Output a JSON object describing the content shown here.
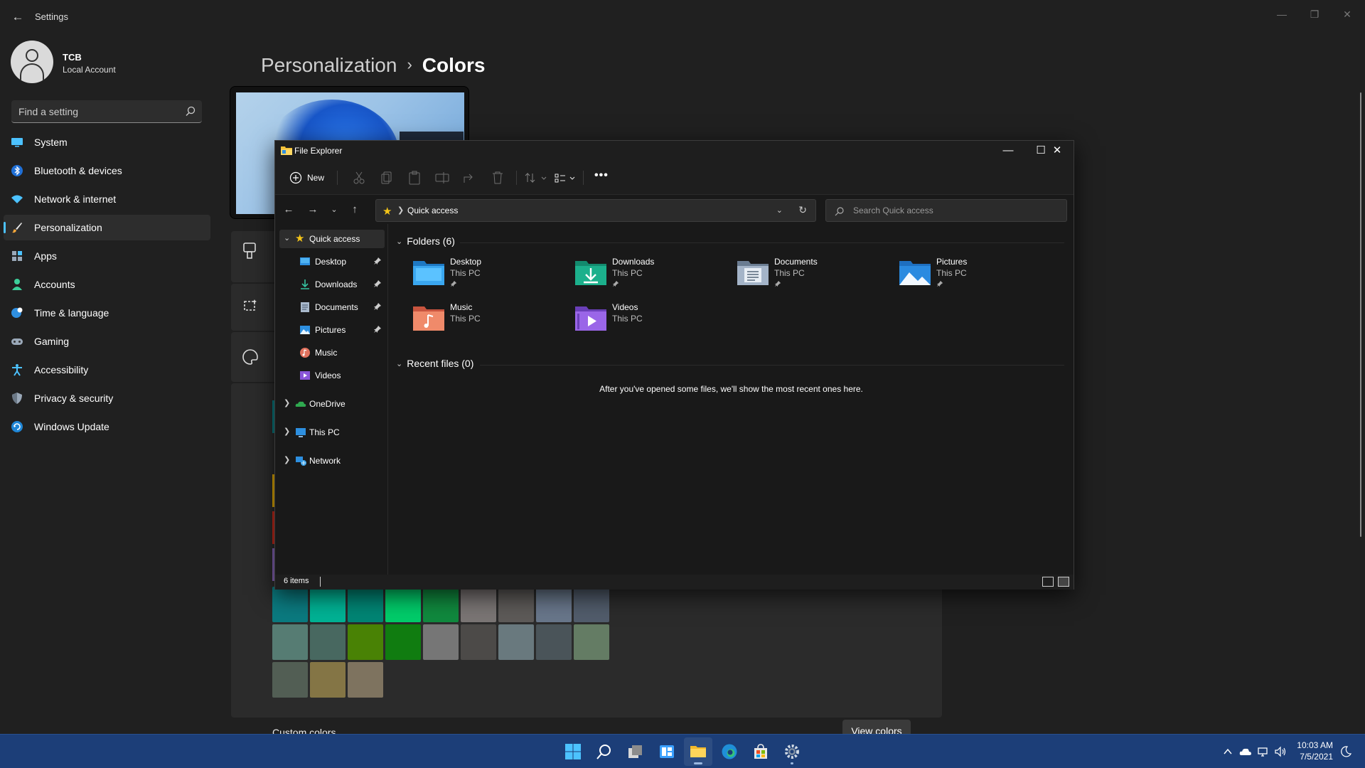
{
  "settings": {
    "window_title": "Settings",
    "profile": {
      "name": "TCB",
      "account_type": "Local Account"
    },
    "search_placeholder": "Find a setting",
    "nav": [
      {
        "label": "System",
        "icon": "monitor-icon"
      },
      {
        "label": "Bluetooth & devices",
        "icon": "bluetooth-icon"
      },
      {
        "label": "Network & internet",
        "icon": "wifi-icon"
      },
      {
        "label": "Personalization",
        "icon": "brush-icon",
        "active": true
      },
      {
        "label": "Apps",
        "icon": "apps-icon"
      },
      {
        "label": "Accounts",
        "icon": "person-icon"
      },
      {
        "label": "Time & language",
        "icon": "globe-clock-icon"
      },
      {
        "label": "Gaming",
        "icon": "gamepad-icon"
      },
      {
        "label": "Accessibility",
        "icon": "accessibility-icon"
      },
      {
        "label": "Privacy & security",
        "icon": "shield-icon"
      },
      {
        "label": "Windows Update",
        "icon": "update-icon"
      }
    ],
    "breadcrumb": {
      "parent": "Personalization",
      "separator": "›",
      "current": "Colors"
    },
    "custom_colors_label": "Custom colors",
    "view_colors_button": "View colors",
    "accent_swatch_colors": [
      [
        "#0b7a7f",
        "#00b294",
        "#018574",
        "#00cc6a",
        "#10893e",
        "#7a7574",
        "#5d5a58",
        "#68768a",
        "#515c6b"
      ],
      [
        "#567c73",
        "#486860",
        "#498205",
        "#107c10",
        "#767676",
        "#4c4a48",
        "#69797e",
        "#4a5459",
        "#647c64"
      ],
      [
        "#525e54",
        "#847545",
        "#7e735f"
      ]
    ]
  },
  "explorer": {
    "title": "File Explorer",
    "toolbar": {
      "new_label": "New",
      "more_label": "•••"
    },
    "address": {
      "path": "Quick access"
    },
    "search_placeholder": "Search Quick access",
    "nav_pane": [
      {
        "label": "Quick access",
        "icon": "star-icon",
        "expanded": true,
        "level": 0
      },
      {
        "label": "Desktop",
        "icon": "desktop-folder-icon",
        "pinned": true,
        "level": 1
      },
      {
        "label": "Downloads",
        "icon": "downloads-folder-icon",
        "pinned": true,
        "level": 1
      },
      {
        "label": "Documents",
        "icon": "documents-folder-icon",
        "pinned": true,
        "level": 1
      },
      {
        "label": "Pictures",
        "icon": "pictures-folder-icon",
        "pinned": true,
        "level": 1
      },
      {
        "label": "Music",
        "icon": "music-folder-icon",
        "level": 1
      },
      {
        "label": "Videos",
        "icon": "videos-folder-icon",
        "level": 1
      },
      {
        "label": "OneDrive",
        "icon": "onedrive-icon",
        "level": 0
      },
      {
        "label": "This PC",
        "icon": "this-pc-icon",
        "level": 0
      },
      {
        "label": "Network",
        "icon": "network-icon",
        "level": 0
      }
    ],
    "folders_header": "Folders (6)",
    "folders": [
      {
        "name": "Desktop",
        "location": "This PC",
        "pinned": true,
        "color": "#1e90d6"
      },
      {
        "name": "Downloads",
        "location": "This PC",
        "pinned": true,
        "color": "#1aa585"
      },
      {
        "name": "Documents",
        "location": "This PC",
        "pinned": true,
        "color": "#8ea3bc"
      },
      {
        "name": "Pictures",
        "location": "This PC",
        "pinned": true,
        "color": "#2a8ae0"
      },
      {
        "name": "Music",
        "location": "This PC",
        "pinned": false,
        "color": "#e2725e"
      },
      {
        "name": "Videos",
        "location": "This PC",
        "pinned": false,
        "color": "#8a56d8"
      }
    ],
    "recent_header": "Recent files (0)",
    "recent_empty_message": "After you've opened some files, we'll show the most recent ones here.",
    "status_text": "6 items"
  },
  "taskbar": {
    "apps": [
      "start-icon",
      "search-icon",
      "task-view-icon",
      "widgets-icon",
      "file-explorer-icon",
      "edge-icon",
      "store-icon",
      "settings-gear-icon"
    ],
    "time": "10:03 AM",
    "date": "7/5/2021"
  }
}
